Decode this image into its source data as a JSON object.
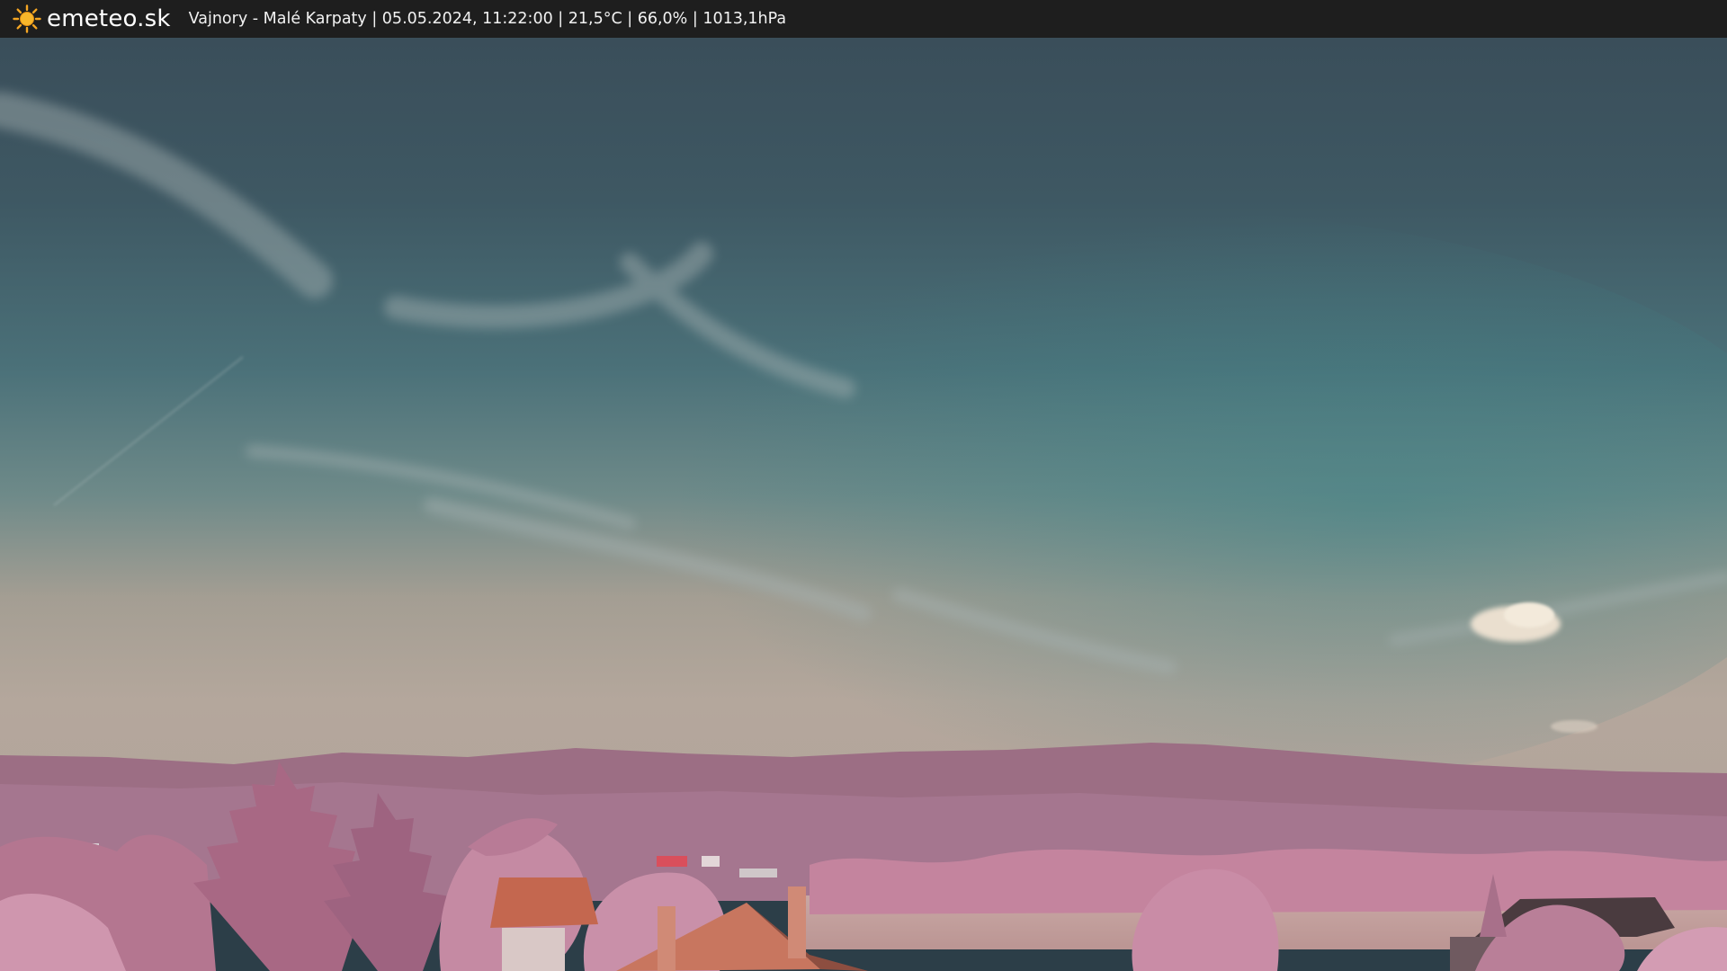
{
  "header": {
    "logo_icon": "sun-icon",
    "brand": "emeteo.sk",
    "info": "Vajnory - Malé Karpaty | 05.05.2024, 11:22:00 | 21,5°C | 66,0% | 1013,1hPa"
  },
  "colors": {
    "bar": "#1e1e1e",
    "sun": "#f5a623",
    "sky_top": "#3d5560",
    "sky_mid": "#4f7a82",
    "horizon": "#b2a69b",
    "hills": "#9a6a82",
    "foliage": "#c98ca6",
    "roof": "#c4674f"
  }
}
